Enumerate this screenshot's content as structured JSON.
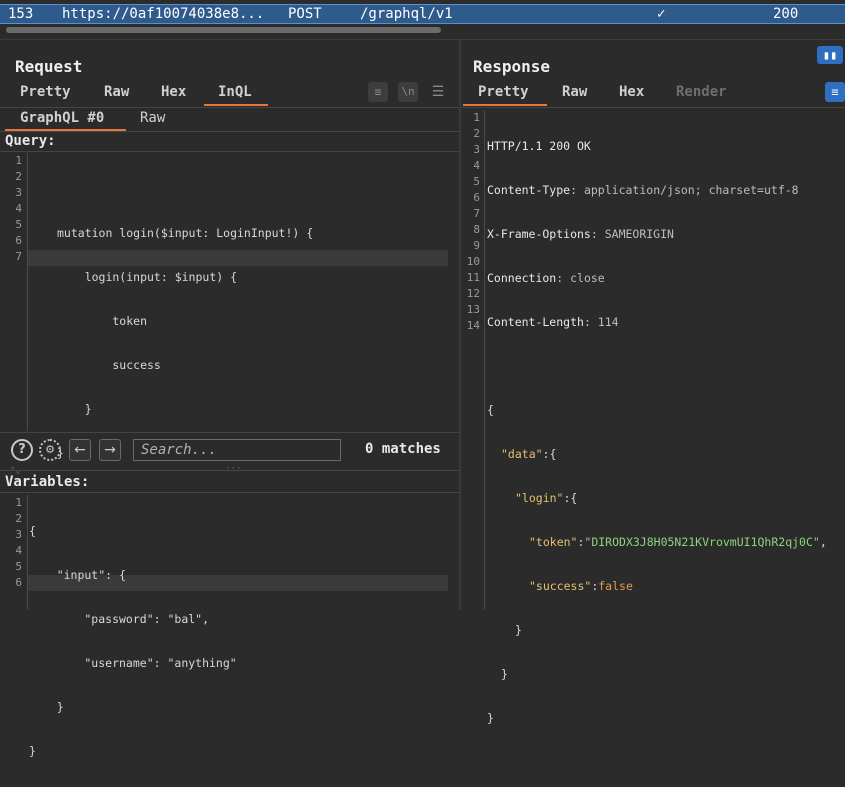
{
  "history_row": {
    "number": "153",
    "url": "https://0af10074038e8...",
    "method": "POST",
    "path": "/graphql/v1",
    "check": "✓",
    "status": "200"
  },
  "request": {
    "title": "Request",
    "tabs": [
      "Pretty",
      "Raw",
      "Hex",
      "InQL"
    ],
    "active_tab": "InQL",
    "subtabs": [
      "GraphQL #0",
      "Raw"
    ],
    "active_subtab": "GraphQL #0",
    "query_label": "Query:",
    "query_lines": [
      "",
      "mutation login($input: LoginInput!) {",
      "    login(input: $input) {",
      "        token",
      "        success",
      "    }",
      "}"
    ],
    "search": {
      "placeholder": "Search...",
      "matches": "0 matches"
    },
    "variables_label": "Variables:",
    "variables_lines": [
      "{",
      "    \"input\": {",
      "        \"password\": \"bal\",",
      "        \"username\": \"anything\"",
      "    }",
      "}"
    ],
    "toolbar_icons": [
      "wrap-icon",
      "newline-icon",
      "menu-icon"
    ]
  },
  "response": {
    "title": "Response",
    "tabs": [
      "Pretty",
      "Raw",
      "Hex",
      "Render"
    ],
    "active_tab": "Pretty",
    "headers": {
      "status_line": "HTTP/1.1 200 OK",
      "items": [
        {
          "name": "Content-Type",
          "value": "application/json; charset=utf-8"
        },
        {
          "name": "X-Frame-Options",
          "value": "SAMEORIGIN"
        },
        {
          "name": "Connection",
          "value": "close"
        },
        {
          "name": "Content-Length",
          "value": "114"
        }
      ]
    },
    "body": {
      "open": "{",
      "data_key": "\"data\"",
      "login_key": "\"login\"",
      "token_key": "\"token\"",
      "token_value": "\"DIRODX3J8H05N21KVrovmUI1QhR2qj0C\"",
      "success_key": "\"success\"",
      "success_value": "false",
      "close": "}"
    },
    "line_numbers": [
      "1",
      "2",
      "3",
      "4",
      "5",
      "6",
      "7",
      "8",
      "9",
      "10",
      "11",
      "12",
      "13",
      "14"
    ]
  },
  "colors": {
    "accent": "#e2773f",
    "selection": "#2f5a8c",
    "json_key": "#e3c16f",
    "json_string": "#8fd37a",
    "json_bool": "#e39a4a"
  }
}
